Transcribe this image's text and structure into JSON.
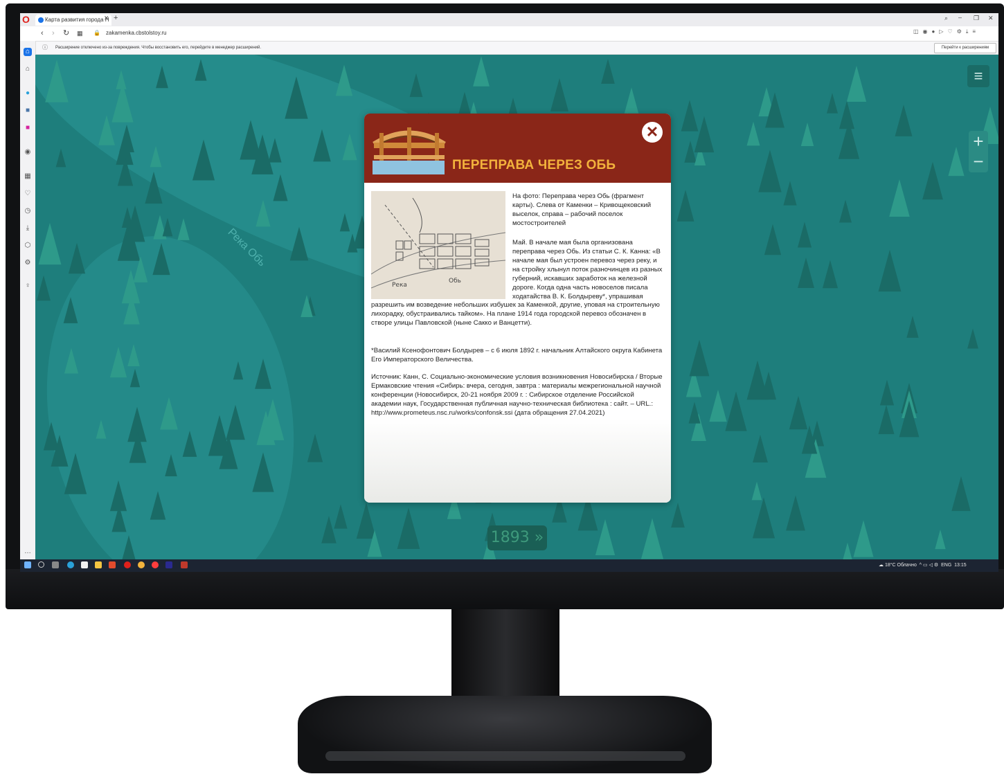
{
  "browser": {
    "tab_title": "Карта развития города Н",
    "url": "zakamenka.cbstolstoy.ru",
    "info_text": "Расширение отключено из-за повреждения. Чтобы восстановить его, перейдите в менеджер расширений.",
    "info_button": "Перейти к расширениям",
    "logo": "O"
  },
  "map": {
    "river_label": "Река Обь",
    "year_button": "1893 »"
  },
  "modal": {
    "title": "ПЕРЕПРАВА ЧЕРЕЗ ОБЬ",
    "photo_labels": [
      "Река",
      "Обь"
    ],
    "para1": "На фото: Переправа через Обь (фрагмент карты). Слева от Каменки – Кривощековский выселок, справа – рабочий поселок мостостроителей",
    "para2": "Май. В начале мая была организована переправа через Обь. Из статьи С. К. Канна: «В начале мая был устроен перевоз через реку, и на стройку хлынул поток разночинцев из разных губерний, искавших заработок на железной дороге. Когда одна часть новоселов писала ходатайства В. К. Болдыреву*, упрашивая",
    "para3": "разрешить им возведение небольших избушек за Каменкой, другие, уповая на строительную лихорадку, обустраивались тайком». На плане 1914 года городской перевоз обозначен в створе улицы Павловской (ныне Сакко и Ванцетти).",
    "para4": "*Василий Ксенофонтович Болдырев – с 6 июля 1892 г. начальник Алтайского округа Кабинета Его Императорского Величества.",
    "para5": "Источник: Канн, С. Социально-экономические условия возникновения Новосибирска / Вторые Ермаковские чтения «Сибирь: вчера, сегодня, завтра : материалы межрегиональной научной конференции (Новосибирск, 20-21 ноября 2009 г. : Сибирское отделение Российской академии наук, Государственная публичная научно-техническая библиотека : сайт. – URL.: http://www.prometeus.nsc.ru/works/confonsk.ssi (дата обращения 27.04.2021)"
  },
  "taskbar": {
    "weather": "18°C Облачно",
    "lang": "ENG",
    "time": "13:15"
  },
  "colors": {
    "map_bg": "#1e7e7c",
    "modal_header": "#8a2618",
    "title_gold": "#f3b23c"
  }
}
